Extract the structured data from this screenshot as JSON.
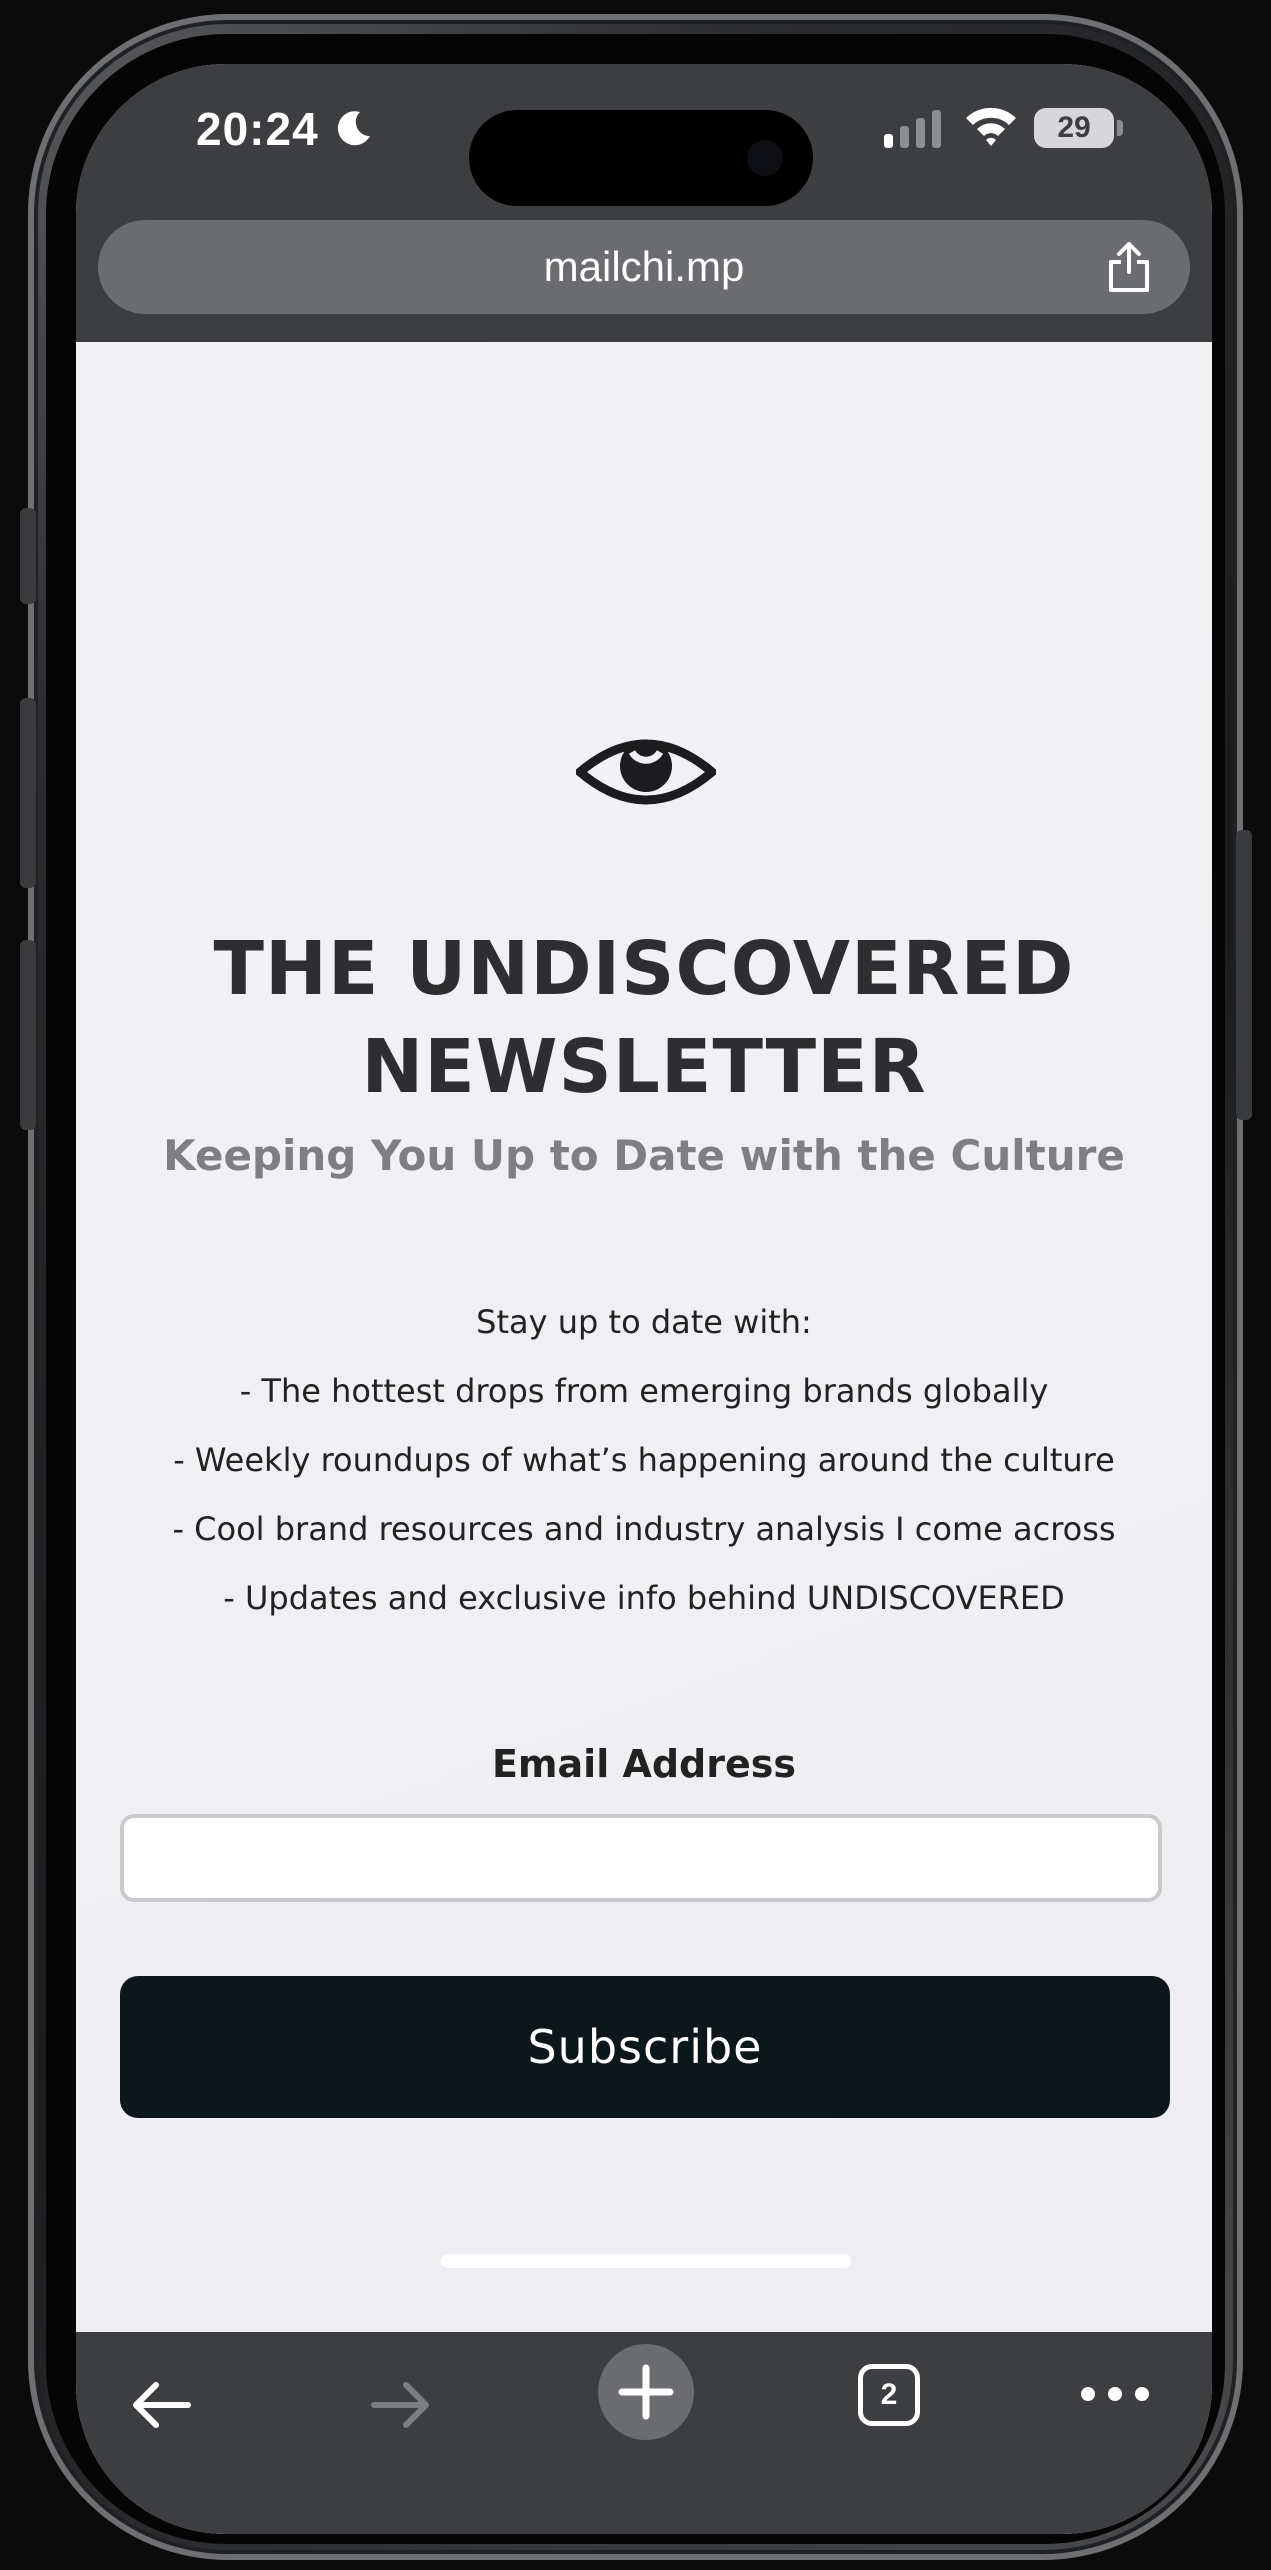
{
  "status_bar": {
    "time": "20:24",
    "battery": "29"
  },
  "browser": {
    "url": "mailchi.mp",
    "tab_count": "2"
  },
  "page": {
    "title_line1": "THE UNDISCOVERED",
    "title_line2": "NEWSLETTER",
    "subtitle": "Keeping You Up to Date with the Culture",
    "intro": "Stay up to date with:",
    "bullets": [
      "-  The hottest drops from emerging brands globally",
      "- Weekly roundups of what’s happening around the culture",
      "- Cool brand resources and industry analysis I come across",
      "- Updates and exclusive info behind UNDISCOVERED"
    ],
    "email_label": "Email Address",
    "email_value": "",
    "subscribe_label": "Subscribe"
  },
  "icons": {
    "logo": "eye-icon",
    "share": "share-icon",
    "back": "arrow-left-icon",
    "forward": "arrow-right-icon",
    "new_tab": "plus-icon",
    "tabs": "tabs-icon",
    "more": "more-icon"
  },
  "colors": {
    "browser_chrome": "#3c3e41",
    "button_bg": "#0c171b",
    "title_text": "#2e2e30",
    "subtitle_text": "#7f7f82"
  }
}
